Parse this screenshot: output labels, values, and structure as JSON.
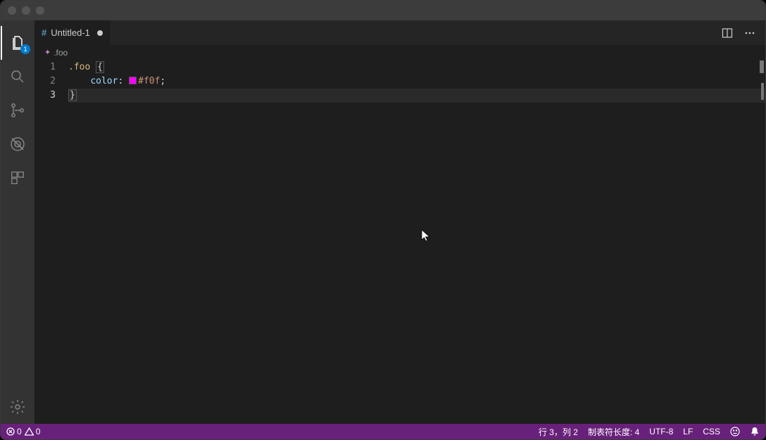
{
  "titlebar": {
    "traffic": [
      "close",
      "minimize",
      "zoom"
    ]
  },
  "activity": {
    "items": [
      {
        "name": "explorer",
        "badge": "1",
        "active": true
      },
      {
        "name": "search"
      },
      {
        "name": "scm"
      },
      {
        "name": "debug"
      },
      {
        "name": "extensions"
      }
    ],
    "bottom": {
      "name": "settings"
    }
  },
  "tab": {
    "lang_glyph": "#",
    "title": "Untitled-1",
    "dirty": true
  },
  "tab_actions": {
    "split": "split-editor",
    "more": "…"
  },
  "breadcrumb": {
    "icon": "css-rule",
    "label": ".foo"
  },
  "editor": {
    "lines": [
      {
        "n": "1",
        "selector": ".foo",
        "open": "{"
      },
      {
        "n": "2",
        "indent": "    ",
        "prop": "color",
        "colon": ": ",
        "swatch": "#ff00ff",
        "value": "#f0f",
        "semi": ";"
      },
      {
        "n": "3",
        "close": "}"
      }
    ],
    "current_line": 3
  },
  "status": {
    "errors": "0",
    "warnings": "0",
    "ln_col": "行 3，列 2",
    "tab_size": "制表符长度: 4",
    "encoding": "UTF-8",
    "eol": "LF",
    "language": "CSS",
    "feedback": "feedback",
    "bell": "notifications"
  }
}
